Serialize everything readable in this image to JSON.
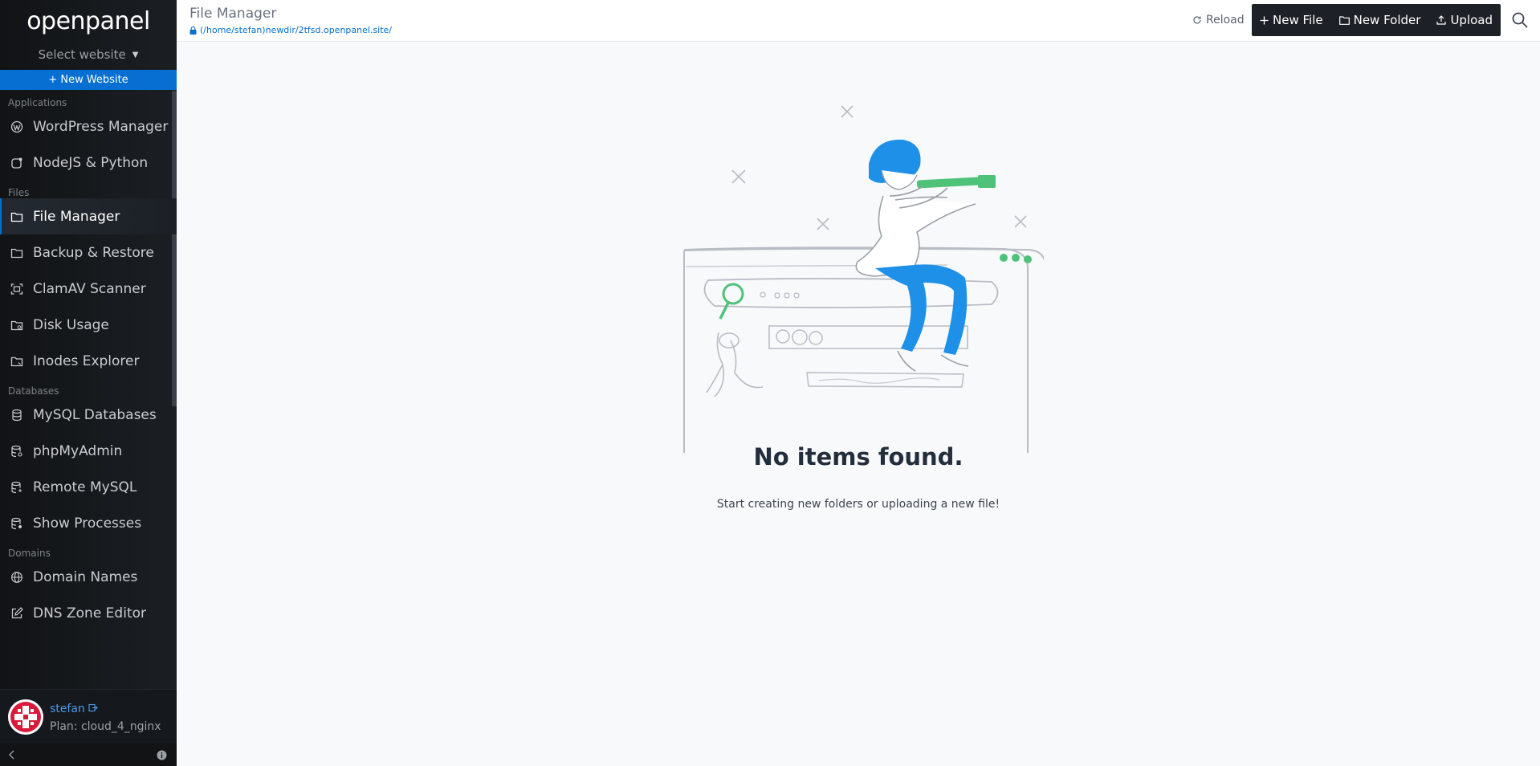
{
  "brand": "openpanel",
  "site_selector": {
    "label": "Select website"
  },
  "new_website": "+ New Website",
  "sidebar": {
    "sections": [
      {
        "label": "Applications",
        "items": [
          {
            "label": "WordPress Manager",
            "icon": "wordpress-icon"
          },
          {
            "label": "NodeJS & Python",
            "icon": "app-icon"
          }
        ]
      },
      {
        "label": "Files",
        "items": [
          {
            "label": "File Manager",
            "icon": "folder-icon",
            "active": true
          },
          {
            "label": "Backup & Restore",
            "icon": "folder-icon"
          },
          {
            "label": "ClamAV Scanner",
            "icon": "scan-icon"
          },
          {
            "label": "Disk Usage",
            "icon": "folder-icon"
          },
          {
            "label": "Inodes Explorer",
            "icon": "folder-icon"
          }
        ]
      },
      {
        "label": "Databases",
        "items": [
          {
            "label": "MySQL Databases",
            "icon": "database-icon"
          },
          {
            "label": "phpMyAdmin",
            "icon": "database-icon"
          },
          {
            "label": "Remote MySQL",
            "icon": "database-icon"
          },
          {
            "label": "Show Processes",
            "icon": "database-icon"
          }
        ]
      },
      {
        "label": "Domains",
        "items": [
          {
            "label": "Domain Names",
            "icon": "globe-icon"
          },
          {
            "label": "DNS Zone Editor",
            "icon": "edit-icon"
          }
        ]
      }
    ]
  },
  "user": {
    "name": "stefan",
    "plan": "Plan: cloud_4_nginx"
  },
  "header": {
    "title": "File Manager",
    "path": "(/home/stefan)newdir/2tfsd.openpanel.site/",
    "reload": "Reload",
    "new_file": "New File",
    "new_folder": "New Folder",
    "upload": "Upload"
  },
  "empty_state": {
    "title": "No items found.",
    "subtitle": "Start creating new folders or uploading a new file!"
  },
  "colors": {
    "accent": "#066fd1",
    "sidebar_bg": "#111315",
    "toolbar_bg": "#1d2127",
    "illustration_blue": "#1e90e8",
    "illustration_green": "#4fc27a"
  }
}
